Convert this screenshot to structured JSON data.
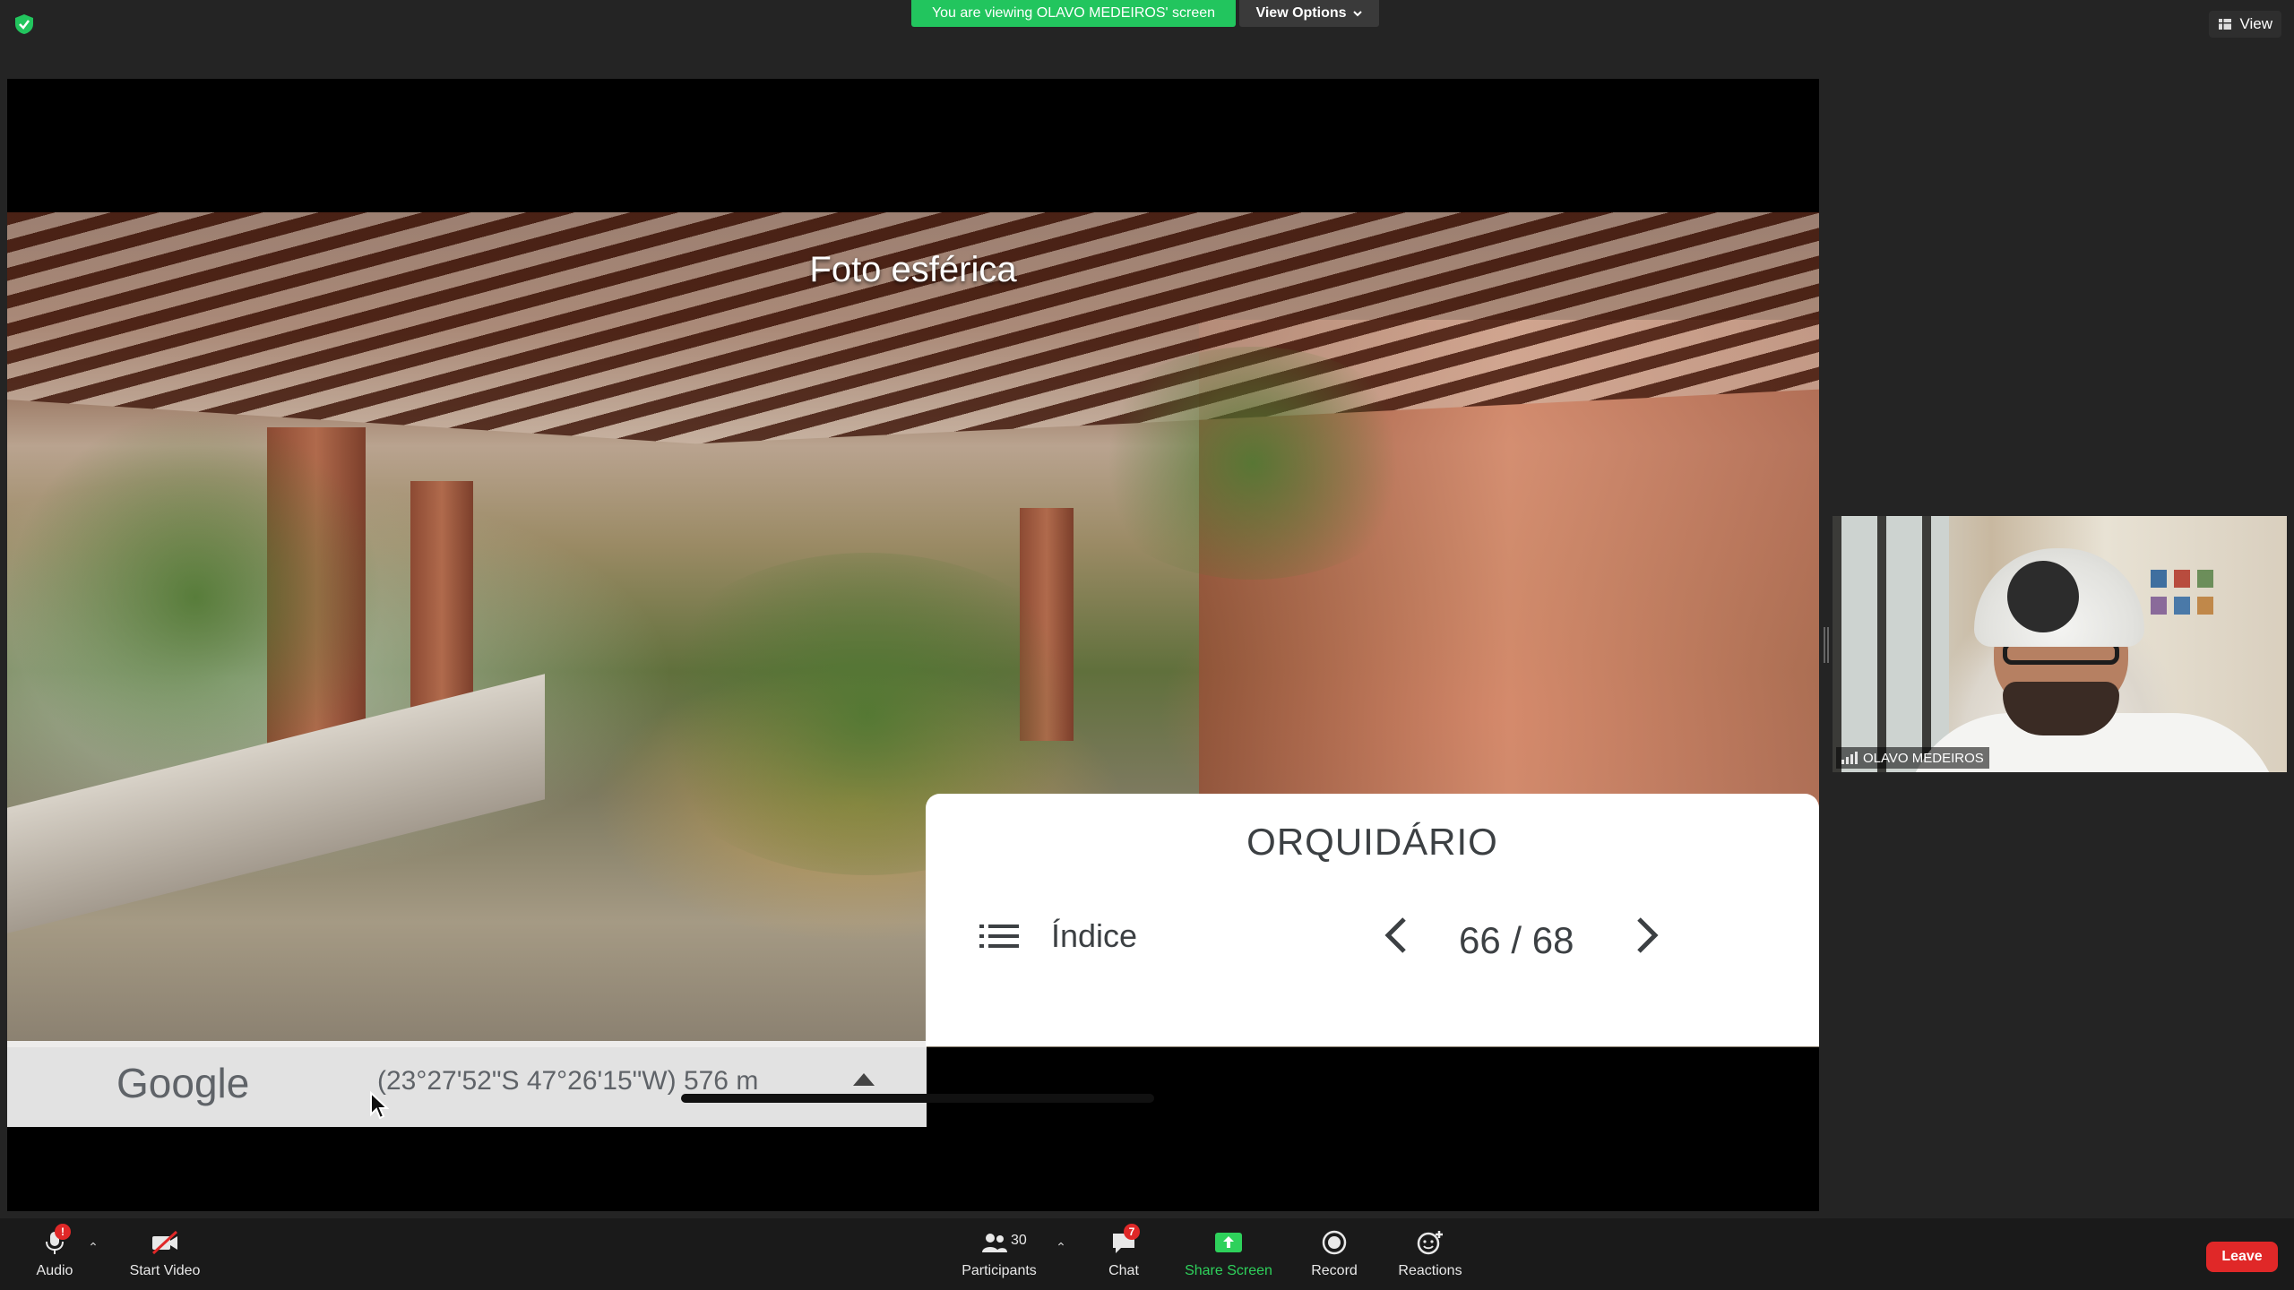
{
  "banner": {
    "viewing_text": "You are viewing OLAVO MEDEIROS' screen",
    "view_options_label": "View Options",
    "view_label": "View"
  },
  "shared_screen": {
    "photo_title": "Foto esférica",
    "google_label": "Google",
    "coordinates": "(23°27'52\"S 47°26'15\"W) 576 m",
    "card": {
      "title": "ORQUIDÁRIO",
      "index_label": "Índice",
      "counter": "66 / 68"
    }
  },
  "participant": {
    "name": "OLAVO MEDEIROS"
  },
  "toolbar": {
    "audio_label": "Audio",
    "audio_badge": "!",
    "start_video_label": "Start Video",
    "participants_label": "Participants",
    "participants_count": "30",
    "chat_label": "Chat",
    "chat_badge": "7",
    "share_screen_label": "Share Screen",
    "record_label": "Record",
    "reactions_label": "Reactions",
    "leave_label": "Leave"
  },
  "colors": {
    "banner_green": "#22c55e",
    "share_green": "#2ed15b",
    "leave_red": "#e02828",
    "toolbar_bg": "#1a1a1a",
    "app_bg": "#242424"
  },
  "icons": [
    "shield-icon",
    "chevron-down-icon",
    "grid-view-icon",
    "list-icon",
    "chevron-left-icon",
    "chevron-right-icon",
    "triangle-up-icon",
    "mouse-cursor-icon",
    "signal-icon",
    "microphone-icon",
    "video-off-icon",
    "participants-icon",
    "chat-icon",
    "share-screen-icon",
    "record-icon",
    "reactions-icon"
  ]
}
